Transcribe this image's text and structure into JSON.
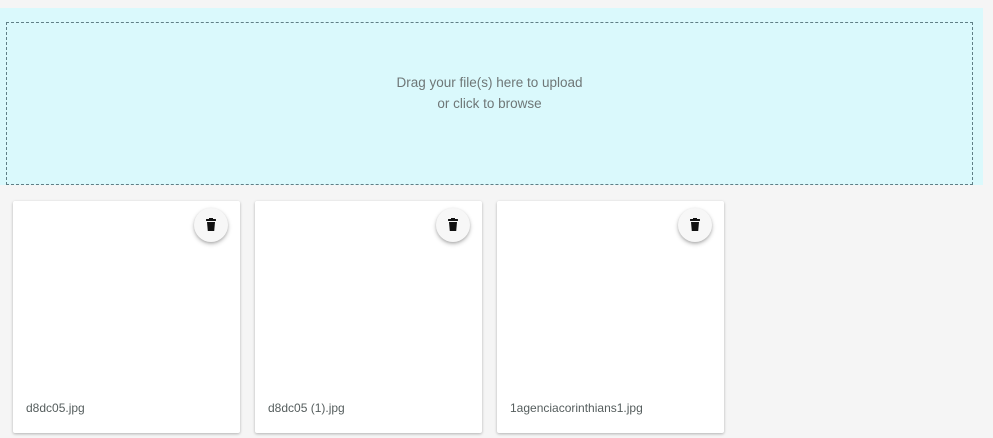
{
  "dropzone": {
    "line1": "Drag your file(s) here to upload",
    "line2": "or click to browse",
    "background_color": "#daf9fc",
    "border_color": "#5f7f86"
  },
  "previews": [
    {
      "file_name": "d8dc05.jpg",
      "action_icon": "trash-icon"
    },
    {
      "file_name": "d8dc05 (1).jpg",
      "action_icon": "trash-icon"
    },
    {
      "file_name": "1agenciacorinthians1.jpg",
      "action_icon": "trash-icon"
    }
  ]
}
